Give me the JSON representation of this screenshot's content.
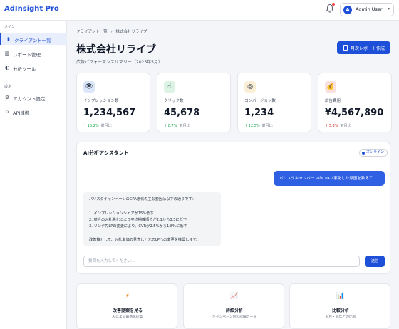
{
  "app": {
    "logo": "AdInsight Pro"
  },
  "topbar": {
    "user_initial": "A",
    "user_name": "Admin User",
    "user_chevron": "▾"
  },
  "sidebar": {
    "section_main": "メイン",
    "section_settings": "設定",
    "items": [
      {
        "label": "クライアント一覧",
        "icon": "building-icon",
        "glyph": "▮"
      },
      {
        "label": "レポート管理",
        "icon": "bar-chart-icon",
        "glyph": "▥"
      },
      {
        "label": "分析ツール",
        "icon": "analysis-icon",
        "glyph": "◐"
      },
      {
        "label": "アカウント設定",
        "icon": "gear-icon",
        "glyph": "⚙"
      },
      {
        "label": "API連携",
        "icon": "code-icon",
        "glyph": "‹›"
      }
    ]
  },
  "breadcrumb": {
    "parent": "クライアント一覧",
    "separator": "›",
    "current": "株式会社リライブ"
  },
  "page": {
    "title": "株式会社リライブ",
    "subtitle": "広告パフォーマンスサマリー（2025年5月）",
    "report_button": "月次レポート作成"
  },
  "kpis": [
    {
      "label": "インプレッション数",
      "value": "1,234,567",
      "change": "↑ 15.2%",
      "trend": "up",
      "compare": "前月比",
      "icon": "eye-icon",
      "glyph": "👁",
      "icon_bg": "#dbe6fb"
    },
    {
      "label": "クリック数",
      "value": "45,678",
      "change": "↑ 8.7%",
      "trend": "up",
      "compare": "前月比",
      "icon": "pointer-icon",
      "glyph": "☝",
      "icon_bg": "#dcf3e4"
    },
    {
      "label": "コンバージョン数",
      "value": "1,234",
      "change": "↑ 12.5%",
      "trend": "up",
      "compare": "前月比",
      "icon": "target-icon",
      "glyph": "◎",
      "icon_bg": "#fbeed6"
    },
    {
      "label": "広告費用",
      "value": "¥4,567,890",
      "change": "↑ 5.3%",
      "trend": "down",
      "compare": "前月比",
      "icon": "money-bag-icon",
      "glyph": "💰",
      "icon_bg": "#fbe0e0"
    }
  ],
  "chat": {
    "title": "AI分析アシスタント",
    "status": "オンライン",
    "user_message": "バリスタキャンペーンのCPAが悪化した原因を教えて",
    "ai_lines": [
      "バリスタキャンペーンのCPA悪化の主な要因は以下の通りです：",
      "1. インプレッションシェアが15%低下",
      "2. 競合の入札強化により平均掲載順位が2.1から3.5に低下",
      "3. リンク先LPの変更により、CVRが2.5%から1.8%に低下",
      "改善策として、入札単価の見直しと元のLPへの変更を推奨します。"
    ],
    "input_placeholder": "質問を入力してください...",
    "send_label": "送信"
  },
  "quick_actions": [
    {
      "title": "改善提案を見る",
      "subtitle": "AIによる最適化提案",
      "icon": "lightning-icon",
      "glyph": "⚡"
    },
    {
      "title": "詳細分析",
      "subtitle": "キャンペーン別の詳細データ",
      "icon": "trend-chart-icon",
      "glyph": "📈"
    },
    {
      "title": "比較分析",
      "subtitle": "前月・前年との比較",
      "icon": "bar-chart-icon",
      "glyph": "📊"
    }
  ]
}
